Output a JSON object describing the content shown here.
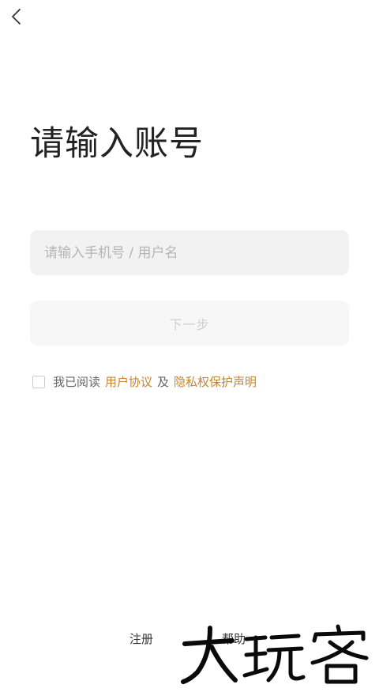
{
  "title": "请输入账号",
  "account_input": {
    "placeholder": "请输入手机号 / 用户名",
    "value": ""
  },
  "next_button": {
    "label": "下一步"
  },
  "agreement": {
    "prefix": "我已阅读",
    "user_agreement": "用户协议",
    "and": "及",
    "privacy_statement": "隐私权保护声明",
    "checked": false
  },
  "footer": {
    "register": "注册",
    "help": "帮助"
  },
  "watermark": {
    "text": "大玩客"
  },
  "colors": {
    "link": "#c7852f",
    "input_bg": "#f2f2f2",
    "button_bg": "#f7f7f7",
    "title": "#222222"
  },
  "icons": {
    "back": "chevron-left-icon"
  }
}
